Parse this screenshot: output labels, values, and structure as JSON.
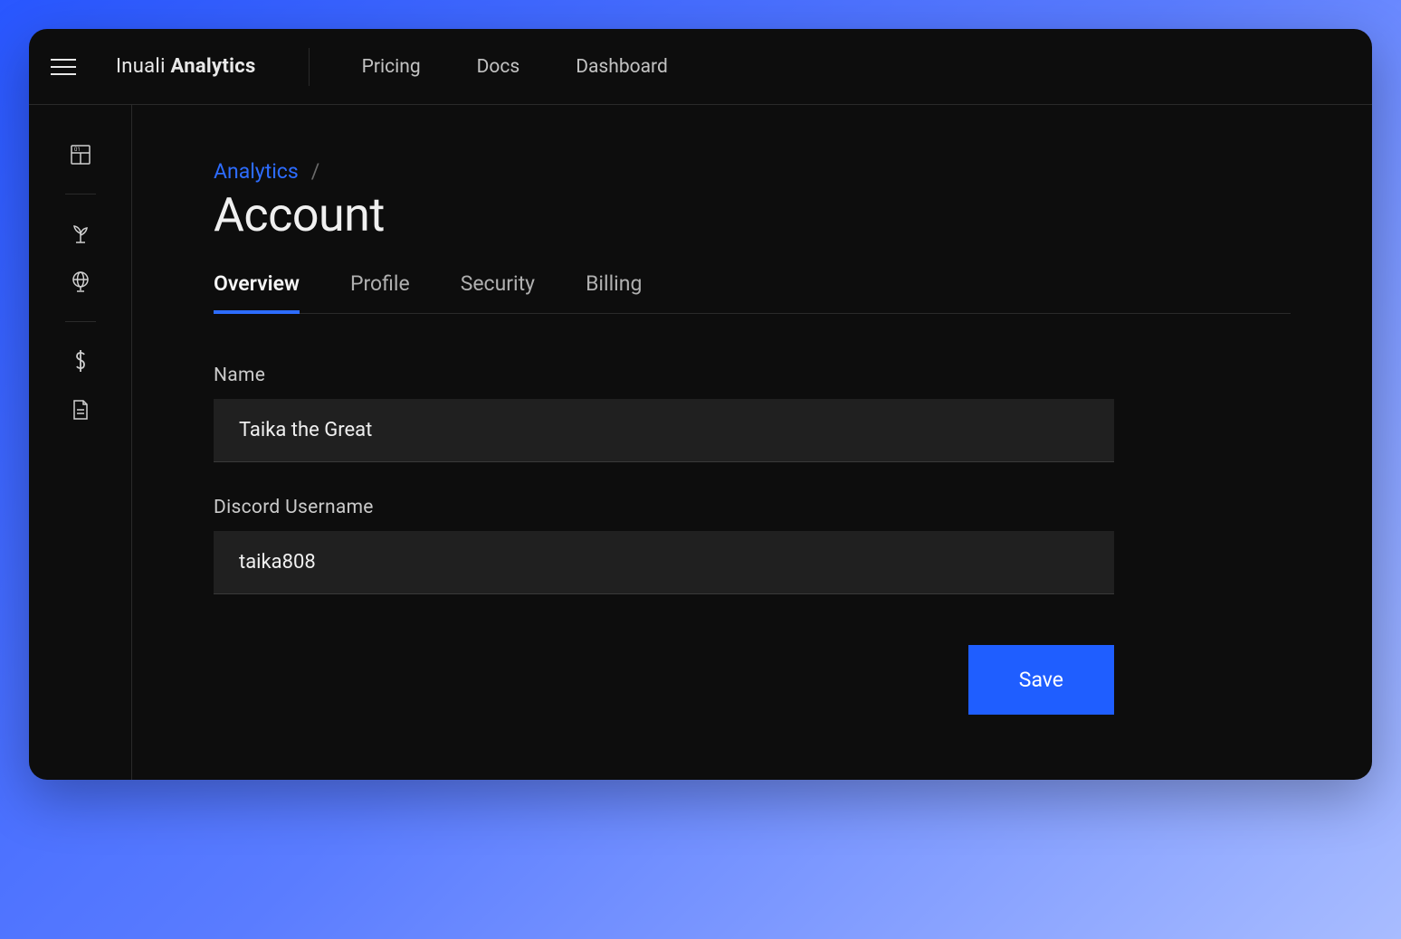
{
  "header": {
    "brand_light": "Inuali ",
    "brand_bold": "Analytics",
    "nav": [
      {
        "label": "Pricing"
      },
      {
        "label": "Docs"
      },
      {
        "label": "Dashboard"
      }
    ]
  },
  "sidebar": {
    "icons": [
      "dashboard-icon",
      "growth-icon",
      "globe-icon",
      "dollar-icon",
      "document-icon"
    ]
  },
  "breadcrumb": {
    "parent": "Analytics",
    "separator": "/"
  },
  "page": {
    "title": "Account"
  },
  "tabs": [
    {
      "label": "Overview",
      "active": true
    },
    {
      "label": "Profile",
      "active": false
    },
    {
      "label": "Security",
      "active": false
    },
    {
      "label": "Billing",
      "active": false
    }
  ],
  "form": {
    "name_label": "Name",
    "name_value": "Taika the Great",
    "discord_label": "Discord Username",
    "discord_value": "taika808"
  },
  "actions": {
    "save_label": "Save"
  },
  "colors": {
    "accent": "#2d6cff",
    "bg": "#0d0d0d",
    "input_bg": "#202020"
  }
}
